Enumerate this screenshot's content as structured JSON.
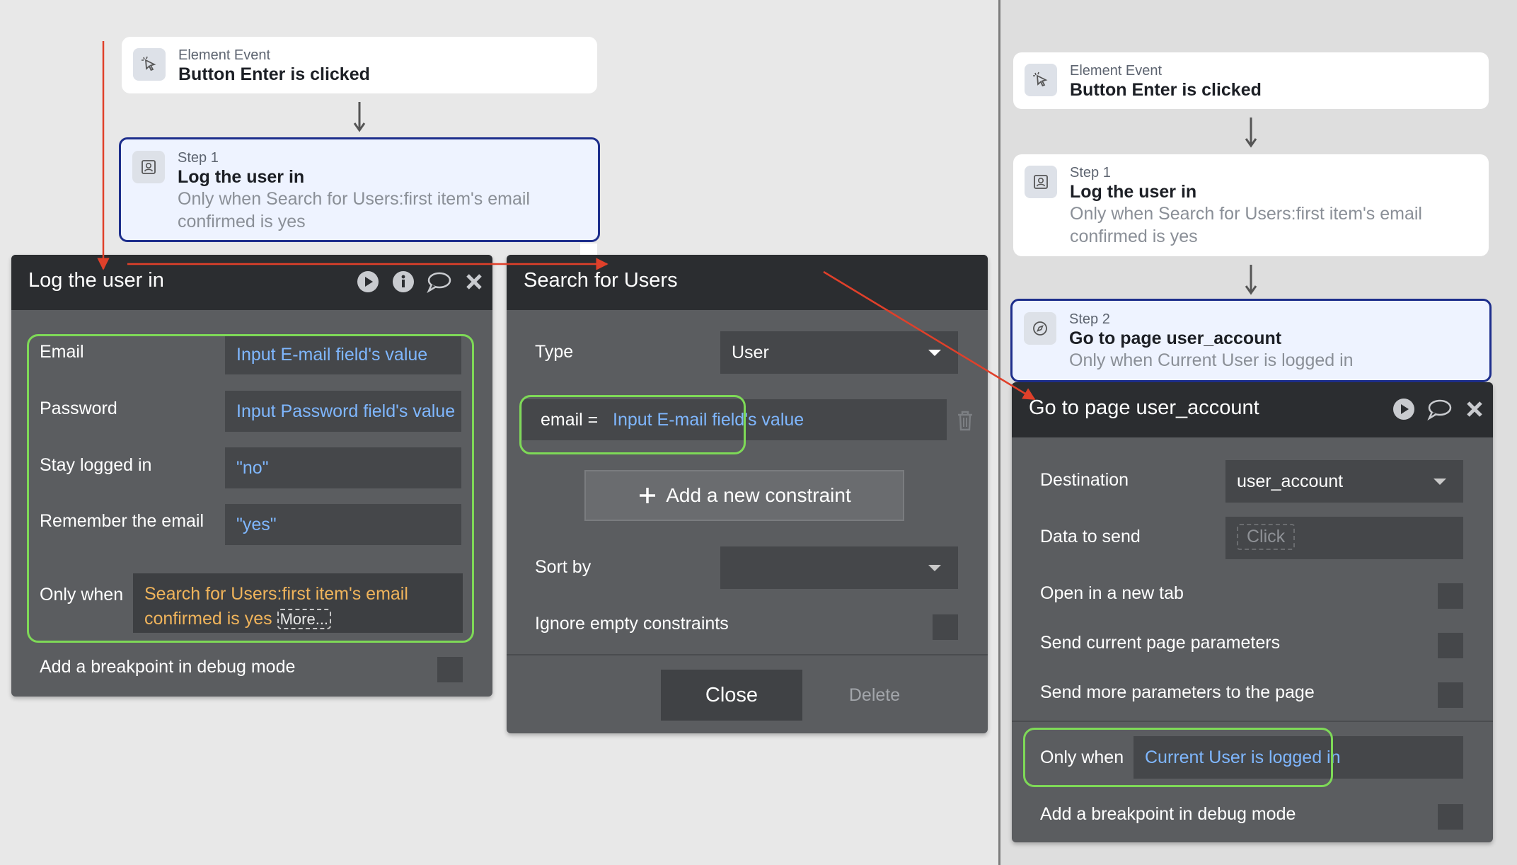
{
  "left_workflow": {
    "event_card": {
      "sub": "Element Event",
      "title": "Button Enter is clicked"
    },
    "step1_card": {
      "sub": "Step 1",
      "title": "Log the user in",
      "cond": "Only when Search for Users:first item's email confirmed is yes"
    }
  },
  "right_workflow": {
    "event_card": {
      "sub": "Element Event",
      "title": "Button Enter is clicked"
    },
    "step1_card": {
      "sub": "Step 1",
      "title": "Log the user in",
      "cond": "Only when Search for Users:first item's email confirmed is yes"
    },
    "step2_card": {
      "sub": "Step 2",
      "title": "Go to page user_account",
      "cond": "Only when Current User is logged in"
    }
  },
  "login_panel": {
    "title": "Log the user in",
    "email_label": "Email",
    "email_value": "Input E-mail field's value",
    "password_label": "Password",
    "password_value": "Input Password field's value",
    "stay_label": "Stay logged in",
    "stay_value": "\"no\"",
    "remember_label": "Remember the email",
    "remember_value": "\"yes\"",
    "only_when_label": "Only when",
    "only_when_value": "Search for Users:first item's email confirmed is yes",
    "more_label": "More...",
    "breakpoint_label": "Add a breakpoint in debug mode"
  },
  "search_panel": {
    "title": "Search for Users",
    "type_label": "Type",
    "type_value": "User",
    "constraint_key": "email =",
    "constraint_value": "Input E-mail field's value",
    "add_constraint": "Add a new constraint",
    "sort_label": "Sort by",
    "ignore_label": "Ignore empty constraints",
    "close_label": "Close",
    "delete_label": "Delete"
  },
  "goto_panel": {
    "title": "Go to page user_account",
    "destination_label": "Destination",
    "destination_value": "user_account",
    "data_label": "Data to send",
    "data_placeholder": "Click",
    "new_tab_label": "Open in a new tab",
    "send_params_label": "Send current page parameters",
    "more_params_label": "Send more parameters to the page",
    "only_when_label": "Only when",
    "only_when_value": "Current User is logged in",
    "breakpoint_label": "Add a breakpoint in debug mode"
  },
  "colors": {
    "highlight": "#7ed957",
    "arrow": "#e0402a",
    "link": "#7fb7ff",
    "condition": "#f0b45b",
    "selected_border": "#1d2e8c"
  },
  "icons": [
    "cursor-click-icon",
    "user-login-icon",
    "compass-icon",
    "play-icon",
    "info-icon",
    "comment-icon",
    "close-icon",
    "trash-icon",
    "plus-icon",
    "dropdown-caret-icon"
  ]
}
